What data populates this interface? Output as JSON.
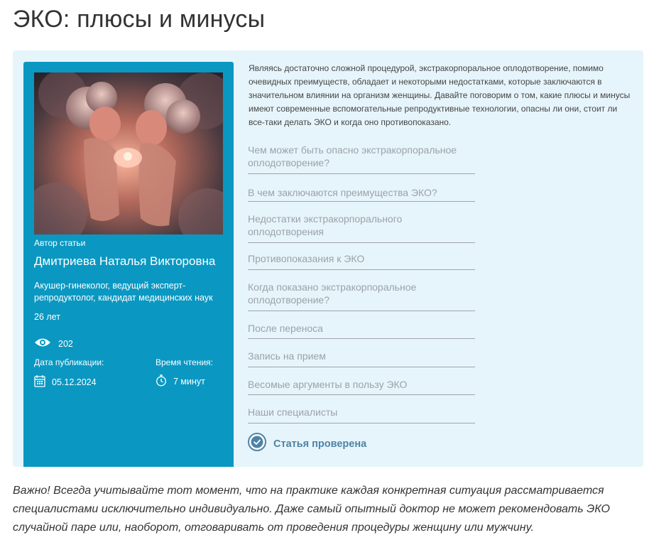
{
  "title": "ЭКО: плюсы и минусы",
  "author": {
    "caption": "Автор статьи",
    "name": "Дмитриева Наталья Викторовна",
    "position": "Акушер-гинеколог, ведущий эксперт-репродуктолог, кандидат медицинских наук",
    "experience": "26 лет",
    "views": "202",
    "published_label": "Дата публикации:",
    "published_date": "05.12.2024",
    "reading_label": "Время чтения:",
    "reading_time": "7 минут"
  },
  "intro": "Являясь достаточно сложной процедурой, экстракорпоральное оплодотворение, помимо очевидных преимуществ, обладает и некоторыми недостатками, которые заключаются в значительном влиянии на организм женщины. Давайте поговорим о том, какие плюсы и минусы имеют современные вспомогательные репродуктивные технологии, опасны ли они, стоит ли все-таки делать ЭКО и когда оно противопоказано.",
  "toc": [
    "Чем может быть опасно экстракорпоральное оплодотворение?",
    "В чем заключаются преимущества ЭКО?",
    "Недостатки экстракорпорального оплодотворения",
    "Противопоказания к ЭКО",
    "Когда показано экстракорпоральное оплодотворение?",
    "После переноса",
    "Запись на прием",
    "Весомые аргументы в пользу ЭКО",
    "Наши специалисты"
  ],
  "verified_label": "Статья проверена",
  "note": "Важно! Всегда учитывайте тот момент, что на практике каждая конкретная ситуация рассматривается специалистами исключительно индивидуально. Даже самый опытный доктор не может рекомендовать ЭКО случайной паре или, наоборот, отговаривать от проведения процедуры женщину или мужчину.",
  "icons": {
    "views": "eye-icon",
    "date": "calendar-icon",
    "reading": "timer-icon",
    "verified": "check-circle-icon"
  },
  "colors": {
    "card": "#0a98c2",
    "box": "#e6f5fb",
    "verified": "#4f83a6"
  }
}
